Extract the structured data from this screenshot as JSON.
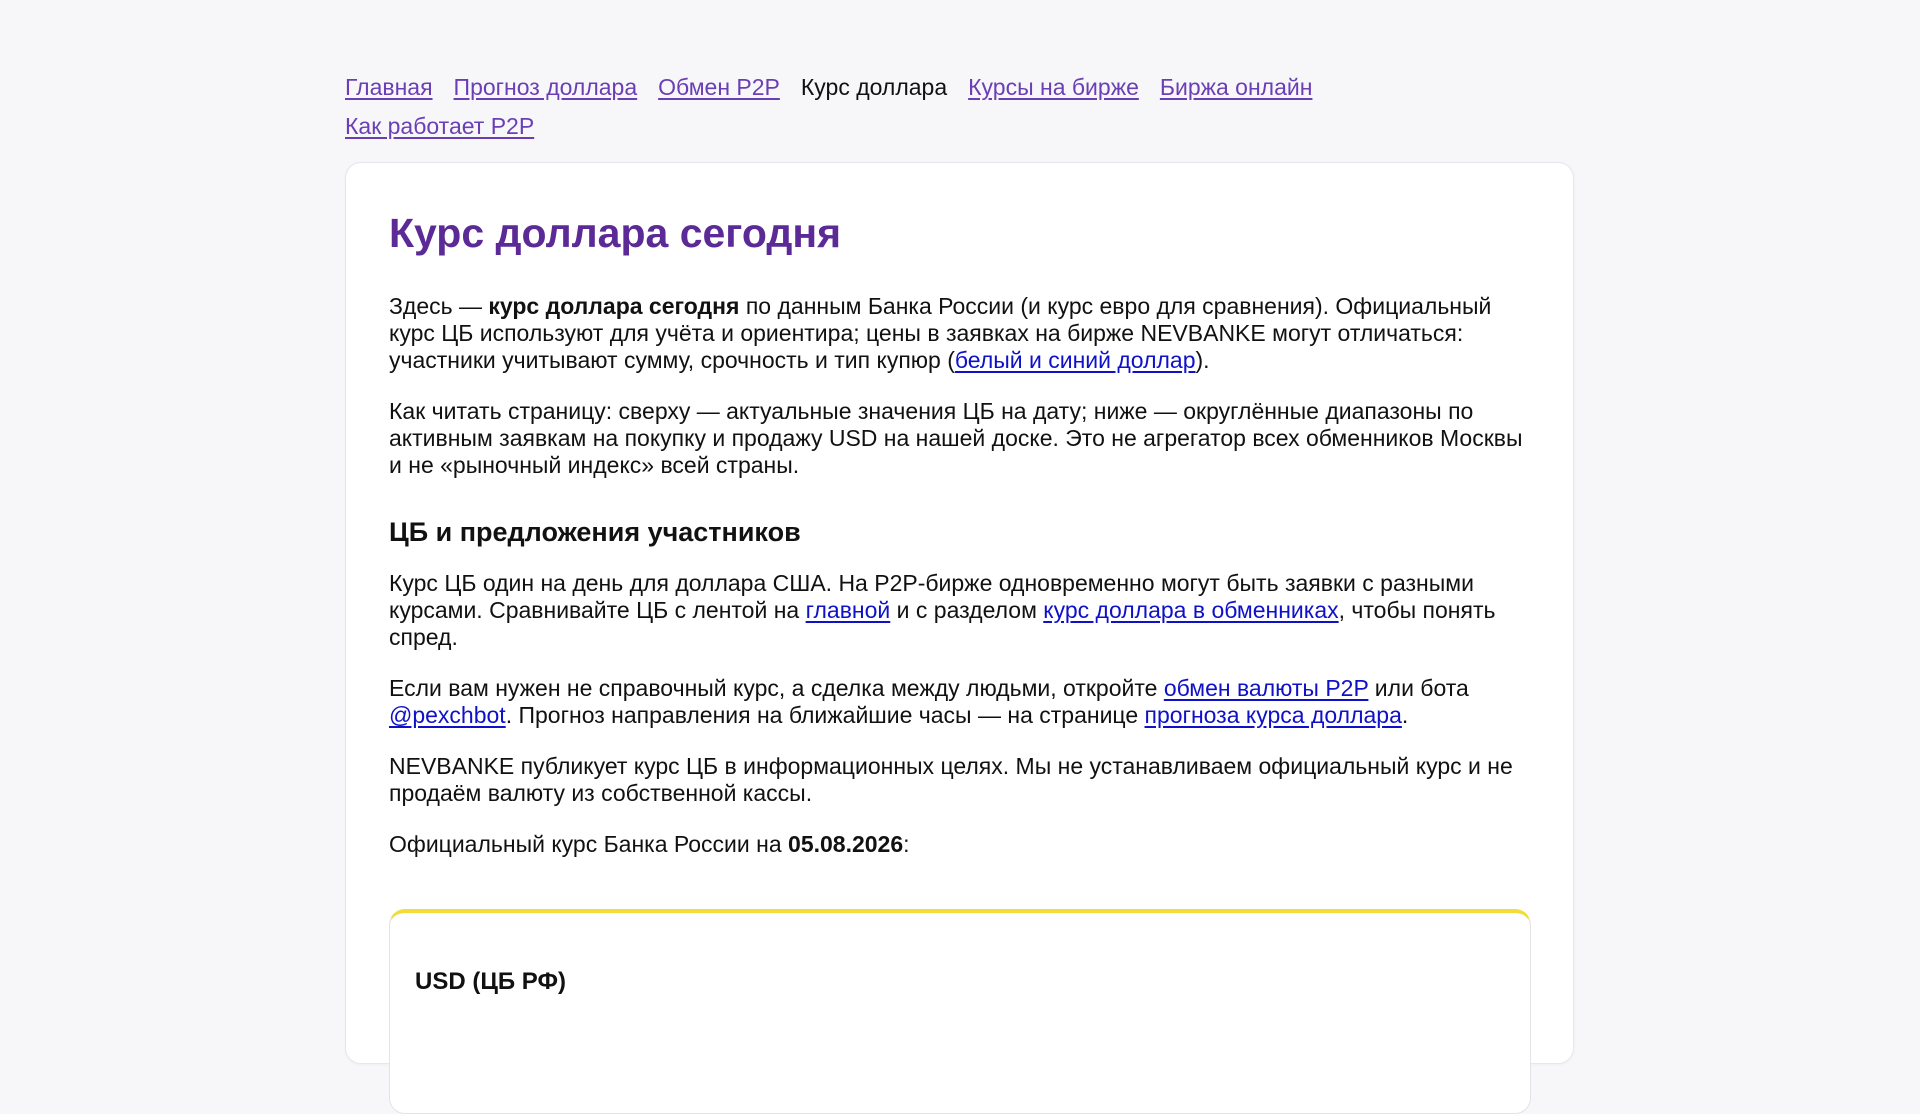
{
  "nav": {
    "items": [
      {
        "label": "Главная",
        "current": false
      },
      {
        "label": "Прогноз доллара",
        "current": false
      },
      {
        "label": "Обмен P2P",
        "current": false
      },
      {
        "label": "Курс доллара",
        "current": true
      },
      {
        "label": "Курсы на бирже",
        "current": false
      },
      {
        "label": "Биржа онлайн",
        "current": false
      },
      {
        "label": "Как работает P2P",
        "current": false
      }
    ]
  },
  "main": {
    "title": "Курс доллара сегодня",
    "intro": {
      "t1": "Здесь — ",
      "b1": "курс доллара сегодня",
      "t2": " по данным Банка России (и курс евро для сравнения). Официальный курс ЦБ используют для учёта и ориентира; цены в заявках на бирже NEVBANKE могут отличаться: участники учитывают сумму, срочность и тип купюр (",
      "link1": "белый и синий доллар",
      "t3": ")."
    },
    "how_to_read": "Как читать страницу: сверху — актуальные значения ЦБ на дату; ниже — округлённые диапазоны по активным заявкам на покупку и продажу USD на нашей доске. Это не агрегатор всех обменников Москвы и не «рыночный индекс» всей страны.",
    "section_title": "ЦБ и предложения участников",
    "cb_para": {
      "t1": "Курс ЦБ один на день для доллара США. На P2P-бирже одновременно могут быть заявки с разными курсами. Сравнивайте ЦБ с лентой на ",
      "link1": "главной",
      "t2": " и с разделом ",
      "link2": "курс доллара в обменниках",
      "t3": ", чтобы понять спред."
    },
    "deal_para": {
      "t1": "Если вам нужен не справочный курс, а сделка между людьми, откройте ",
      "link1": "обмен валюты P2P",
      "t2": " или бота ",
      "link2": "@pexchbot",
      "t3": ". Прогноз направления на ближайшие часы — на странице ",
      "link3": "прогноза курса доллара",
      "t4": "."
    },
    "disclaimer": "NEVBANKE публикует курс ЦБ в информационных целях. Мы не устанавливаем официальный курс и не продаём валюту из собственной кассы.",
    "official": {
      "t1": "Официальный курс Банка России на ",
      "date": "05.08.2026",
      "t2": ":"
    },
    "rate_card": {
      "title": "USD (ЦБ РФ)"
    }
  },
  "colors": {
    "background": "#f7f7f9",
    "title": "#5b2a96",
    "nav_link": "#6a3fb6",
    "link": "#0f11c9",
    "rate_card_accent": "#f2dc38"
  }
}
